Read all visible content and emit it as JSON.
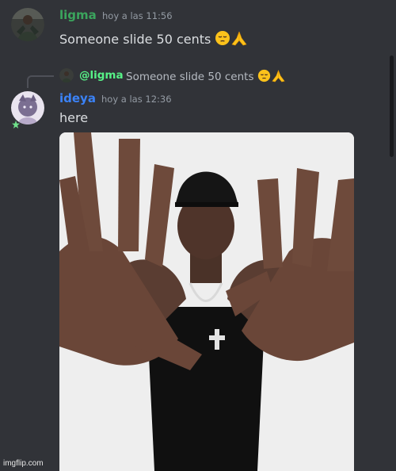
{
  "colors": {
    "background": "#313338",
    "ligma_name": "#3ba55d",
    "ideya_name": "#3b82f6",
    "mention": "#57f287"
  },
  "messages": [
    {
      "username": "ligma",
      "timestamp": "hoy a las 11:56",
      "text": "Someone slide 50 cents"
    },
    {
      "reply": {
        "username": "@ligma",
        "text": "Someone slide 50 cents"
      },
      "username": "ideya",
      "timestamp": "hoy a las 12:36",
      "text": "here"
    }
  ],
  "icons": [
    "pensive-face-emoji-icon",
    "folded-hands-emoji-icon"
  ],
  "watermark": "imgflip.com"
}
